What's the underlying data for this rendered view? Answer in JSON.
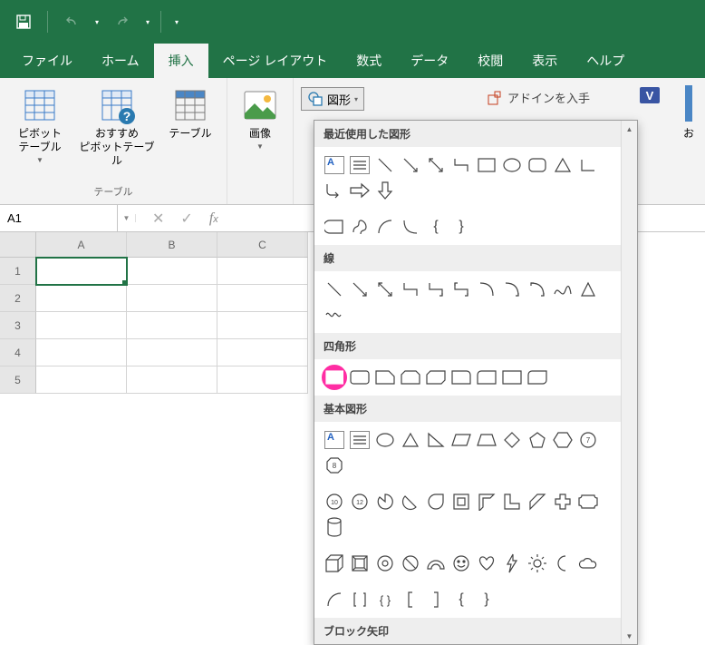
{
  "titlebar": {
    "save": "保存"
  },
  "tabs": [
    "ファイル",
    "ホーム",
    "挿入",
    "ページ レイアウト",
    "数式",
    "データ",
    "校閲",
    "表示",
    "ヘルプ"
  ],
  "active_tab": 2,
  "ribbon": {
    "pivot": "ピボット\nテーブル",
    "rec_pivot": "おすすめ\nピボットテーブル",
    "table": "テーブル",
    "tables_group": "テーブル",
    "image": "画像",
    "shapes": "図形",
    "addins": "アドインを入手",
    "other_addin_initial": "お"
  },
  "formula_bar": {
    "cell_ref": "A1"
  },
  "grid": {
    "cols": [
      "A",
      "B",
      "C"
    ],
    "rows": [
      "1",
      "2",
      "3",
      "4",
      "5"
    ]
  },
  "panel": {
    "recent": "最近使用した図形",
    "lines": "線",
    "rects": "四角形",
    "basic": "基本図形",
    "block_arrows": "ブロック矢印"
  }
}
